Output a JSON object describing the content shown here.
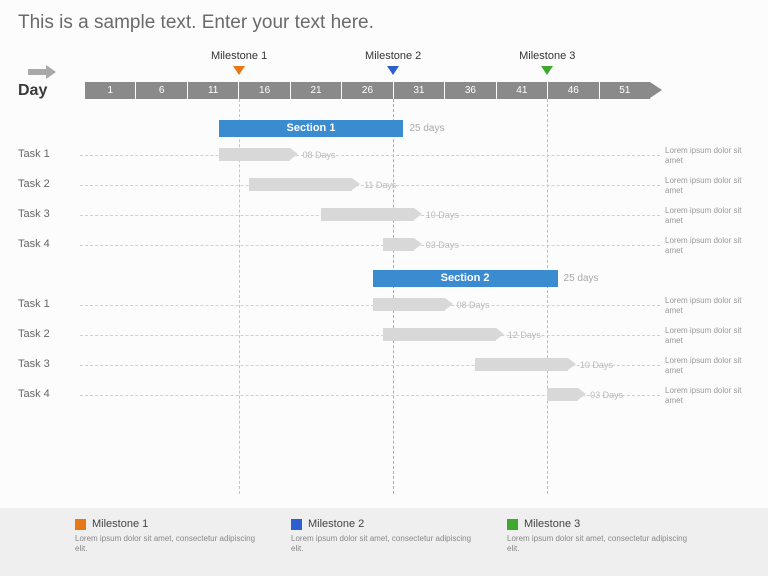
{
  "title": "This is a sample text. Enter your text here.",
  "day_label": "Day",
  "axis_ticks": [
    "1",
    "6",
    "11",
    "16",
    "21",
    "26",
    "31",
    "36",
    "41",
    "46",
    "51"
  ],
  "milestones": [
    {
      "label": "Milestone 1",
      "day": 16,
      "color": "#e67817"
    },
    {
      "label": "Milestone 2",
      "day": 31,
      "color": "#2e5fd0"
    },
    {
      "label": "Milestone 3",
      "day": 46,
      "color": "#3fa82f"
    }
  ],
  "sections": [
    {
      "name": "Section 1",
      "start": 14,
      "end": 32,
      "duration": "25 days",
      "y": 70,
      "tasks": [
        {
          "label": "Task 1",
          "start": 14,
          "end": 21,
          "duration": "08 Days",
          "y": 98
        },
        {
          "label": "Task 2",
          "start": 17,
          "end": 27,
          "duration": "11 Days",
          "y": 128
        },
        {
          "label": "Task 3",
          "start": 24,
          "end": 33,
          "duration": "10 Days",
          "y": 158
        },
        {
          "label": "Task 4",
          "start": 30,
          "end": 33,
          "duration": "03 Days",
          "y": 188
        }
      ]
    },
    {
      "name": "Section 2",
      "start": 29,
      "end": 47,
      "duration": "25 days",
      "y": 220,
      "tasks": [
        {
          "label": "Task 1",
          "start": 29,
          "end": 36,
          "duration": "08 Days",
          "y": 248
        },
        {
          "label": "Task 2",
          "start": 30,
          "end": 41,
          "duration": "12 Days",
          "y": 278
        },
        {
          "label": "Task 3",
          "start": 39,
          "end": 48,
          "duration": "10 Days",
          "y": 308
        },
        {
          "label": "Task 4",
          "start": 46,
          "end": 49,
          "duration": "03 Days",
          "y": 338
        }
      ]
    }
  ],
  "side_note": "Lorem ipsum dolor sit amet",
  "legend": [
    {
      "color": "#e67817",
      "title": "Milestone 1",
      "desc": "Lorem ipsum dolor sit amet, consectetur adipiscing elit."
    },
    {
      "color": "#2e5fd0",
      "title": "Milestone 2",
      "desc": "Lorem ipsum dolor sit amet, consectetur adipiscing elit."
    },
    {
      "color": "#3fa82f",
      "title": "Milestone 3",
      "desc": "Lorem ipsum dolor sit amet, consectetur adipiscing elit."
    }
  ],
  "chart_data": {
    "type": "gantt",
    "x_unit": "day",
    "x_ticks": [
      1,
      6,
      11,
      16,
      21,
      26,
      31,
      36,
      41,
      46,
      51
    ],
    "milestones": [
      {
        "name": "Milestone 1",
        "day": 16
      },
      {
        "name": "Milestone 2",
        "day": 31
      },
      {
        "name": "Milestone 3",
        "day": 46
      }
    ],
    "series": [
      {
        "group": "Section 1",
        "start": 14,
        "duration": 25,
        "tasks": [
          {
            "name": "Task 1",
            "start": 14,
            "duration": 8
          },
          {
            "name": "Task 2",
            "start": 17,
            "duration": 11
          },
          {
            "name": "Task 3",
            "start": 24,
            "duration": 10
          },
          {
            "name": "Task 4",
            "start": 30,
            "duration": 3
          }
        ]
      },
      {
        "group": "Section 2",
        "start": 29,
        "duration": 25,
        "tasks": [
          {
            "name": "Task 1",
            "start": 29,
            "duration": 8
          },
          {
            "name": "Task 2",
            "start": 30,
            "duration": 12
          },
          {
            "name": "Task 3",
            "start": 39,
            "duration": 10
          },
          {
            "name": "Task 4",
            "start": 46,
            "duration": 3
          }
        ]
      }
    ]
  }
}
